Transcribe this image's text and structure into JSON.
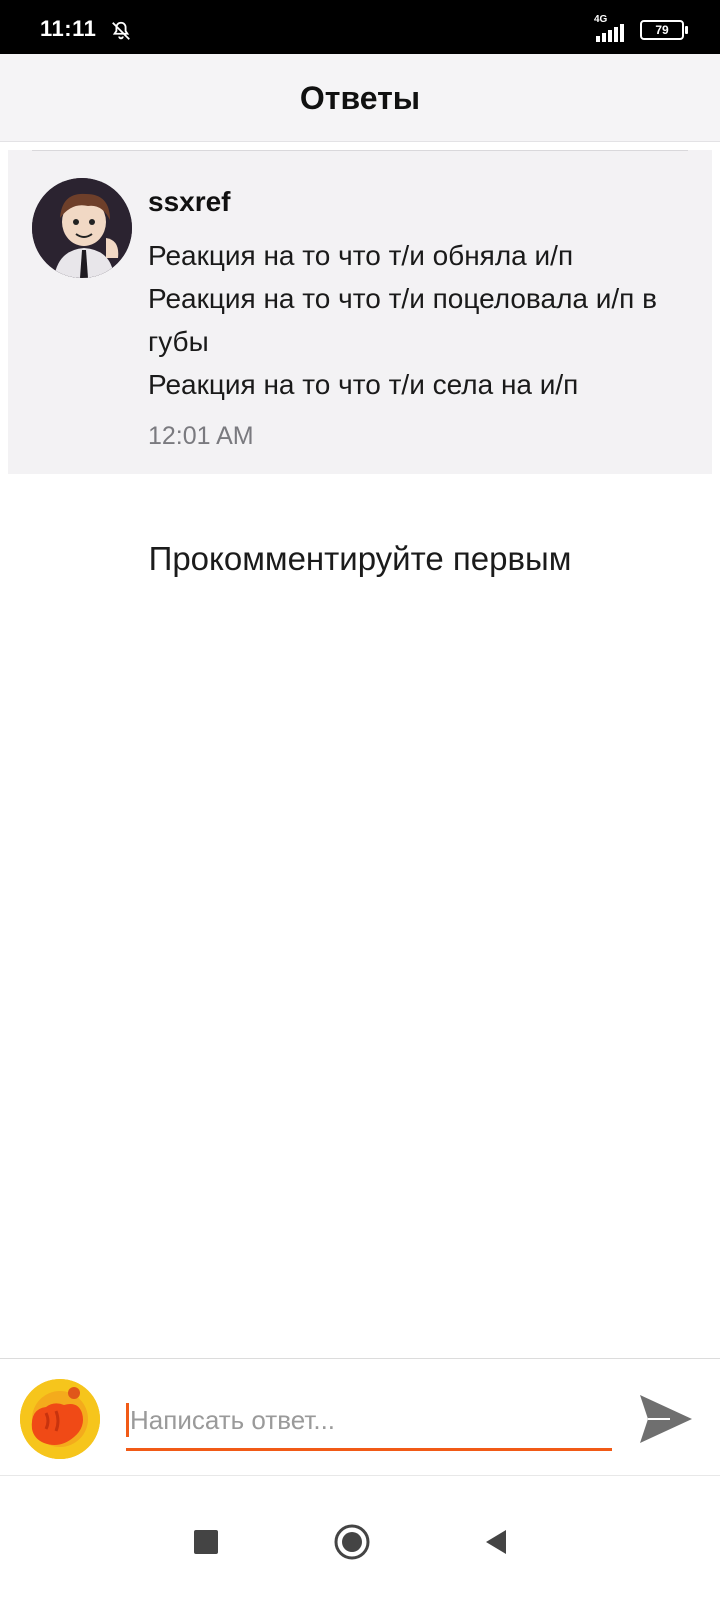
{
  "status_bar": {
    "time": "11:11",
    "network": "4G",
    "battery": "79"
  },
  "header": {
    "title": "Ответы"
  },
  "comment": {
    "username": "ssxref",
    "text": "Реакция на то что т/и обняла и/п\nРеакция на то что т/и поцеловала и/п в губы\nРеакция на то что т/и села на и/п",
    "time": "12:01 AM"
  },
  "empty_state": {
    "text": "Прокомментируйте первым"
  },
  "reply": {
    "placeholder": "Написать ответ..."
  },
  "colors": {
    "accent": "#f15a16",
    "header_bg": "#f5f4f6",
    "card_bg": "#f3f2f4"
  },
  "icons": {
    "mute": "bell-off-icon",
    "send": "send-icon",
    "nav_recent": "square-icon",
    "nav_home": "circle-icon",
    "nav_back": "triangle-back-icon"
  }
}
